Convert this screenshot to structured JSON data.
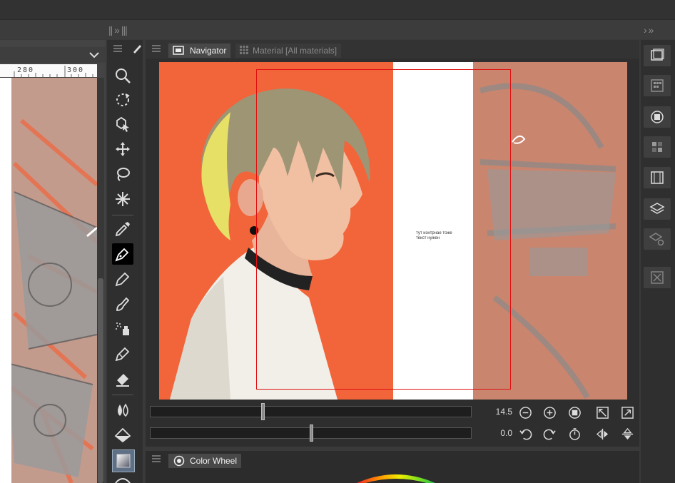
{
  "window": {
    "top_strip": ""
  },
  "panel_headers": {
    "collapse_glyph": "|| »  |||",
    "right_collapse": "›   »"
  },
  "ruler": {
    "marks": [
      "280",
      "300"
    ]
  },
  "navigator": {
    "tabs": [
      {
        "label": "Navigator",
        "icon": "navigator-icon",
        "active": true
      },
      {
        "label": "Material [All materials]",
        "icon": "material-grid-icon",
        "active": false
      }
    ],
    "canvas_text": [
      "тут изнтрнае тоже",
      "текст нужен"
    ],
    "zoom_value": "14.5",
    "rotate_value": "0.0",
    "zoom_slider_position": 0.35,
    "rotate_slider_position": 0.5
  },
  "color_wheel": {
    "tab_label": "Color Wheel"
  },
  "tools": [
    "zoom-icon",
    "move-canvas-icon",
    "object-select-icon",
    "move-layer-icon",
    "lasso-icon",
    "magic-wand-icon",
    "eyedropper-icon",
    "pen-icon",
    "pencil-icon",
    "brush-icon",
    "airbrush-icon",
    "decoration-icon",
    "eraser-icon",
    "blend-icon",
    "fill-icon",
    "gradient-icon"
  ],
  "colors": {
    "accent_orange": "#f2643a",
    "frame_red": "#e01010",
    "panel_dark": "#2e2e2e"
  }
}
